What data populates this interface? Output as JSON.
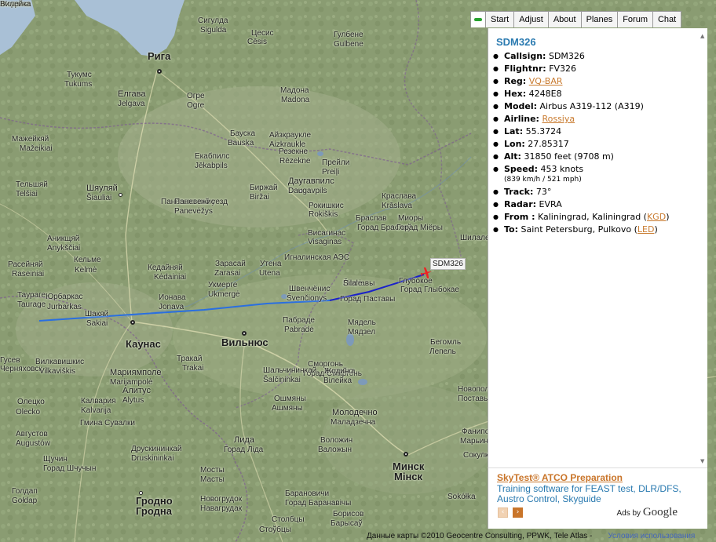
{
  "tabs": [
    "Start",
    "Adjust",
    "About",
    "Planes",
    "Forum",
    "Chat"
  ],
  "flight": {
    "title": "SDM326",
    "rows": [
      {
        "label": "Callsign:",
        "value": "SDM326"
      },
      {
        "label": "Flightnr:",
        "value": "FV326"
      },
      {
        "label": "Reg:",
        "value": "VQ-BAR",
        "link": true
      },
      {
        "label": "Hex:",
        "value": "4248E8"
      },
      {
        "label": "Model:",
        "value": "Airbus A319-112 (A319)"
      },
      {
        "label": "Airline:",
        "value": "Rossiya",
        "link": true
      },
      {
        "label": "Lat:",
        "value": "55.3724"
      },
      {
        "label": "Lon:",
        "value": "27.85317"
      },
      {
        "label": "Alt:",
        "value": "31850 feet (9708 m)"
      },
      {
        "label": "Speed:",
        "value": "453 knots",
        "sub": "(839 km/h / 521 mph)"
      },
      {
        "label": "Track:",
        "value": "73°"
      },
      {
        "label": "Radar:",
        "value": "EVRA"
      }
    ],
    "from": {
      "label": "From :",
      "value": "Kaliningrad, Kaliningrad (",
      "code": "KGD",
      "tail": ")"
    },
    "to": {
      "label": "To:",
      "value": "Saint Petersburg, Pulkovo (",
      "code": "LED",
      "tail": ")"
    }
  },
  "ad": {
    "title": "SkyTest® ATCO Preparation",
    "body": "Training software for FEAST test, DLR/DFS, Austro Control, Skyguide",
    "ads_by": "Ads by",
    "brand": "Google"
  },
  "map": {
    "plane_label": "SDM326",
    "attribution": "Данные карты ©2010 Geocentre Consulting, PPWK, Tele Atlas -",
    "terms": "Условия использования",
    "labels": [
      {
        "t": "Рига",
        "cls": "major"
      },
      {
        "t": "Елгава",
        "cls": "medium"
      },
      {
        "t": "Jelgava",
        "cls": ""
      },
      {
        "t": "Шяуляй",
        "cls": "medium"
      },
      {
        "t": "Šiauliai",
        "cls": ""
      },
      {
        "t": "Панeвежский уезд",
        "cls": ""
      },
      {
        "t": "Даугавпилс",
        "cls": "medium"
      },
      {
        "t": "Daugavpils",
        "cls": ""
      },
      {
        "t": "Каунас",
        "cls": "major"
      },
      {
        "t": "Вильнюс",
        "cls": "major"
      },
      {
        "t": "Минск",
        "cls": "major"
      },
      {
        "t": "Мінск",
        "cls": "major"
      },
      {
        "t": "Мариямполе",
        "cls": "medium"
      },
      {
        "t": "Marijampolė",
        "cls": ""
      },
      {
        "t": "Алитус",
        "cls": "medium"
      },
      {
        "t": "Alytus",
        "cls": ""
      },
      {
        "t": "Гродно",
        "cls": "major"
      },
      {
        "t": "Гродна",
        "cls": "major"
      },
      {
        "t": "Лида",
        "cls": "medium"
      },
      {
        "t": "Горад Ліда",
        "cls": ""
      },
      {
        "t": "Молодечно",
        "cls": "medium"
      },
      {
        "t": "Маладзечна",
        "cls": ""
      },
      {
        "t": "Поставы",
        "cls": ""
      },
      {
        "t": "Горад Паставы",
        "cls": ""
      },
      {
        "t": "Глубокое",
        "cls": ""
      },
      {
        "t": "Горад Глыбокае",
        "cls": ""
      },
      {
        "t": "Мядель",
        "cls": ""
      },
      {
        "t": "Мядзел",
        "cls": ""
      },
      {
        "t": "Кедайняй",
        "cls": ""
      },
      {
        "t": "Kėdainiai",
        "cls": ""
      },
      {
        "t": "Утена",
        "cls": ""
      },
      {
        "t": "Utena",
        "cls": ""
      },
      {
        "t": "Паневежис",
        "cls": ""
      },
      {
        "t": "Panevėžys",
        "cls": ""
      },
      {
        "t": "Тельшяй",
        "cls": ""
      },
      {
        "t": "Telšiai",
        "cls": ""
      },
      {
        "t": "Мажейкяй",
        "cls": ""
      },
      {
        "t": "Mažeikiai",
        "cls": ""
      },
      {
        "t": "Тукумс",
        "cls": ""
      },
      {
        "t": "Tukums",
        "cls": ""
      },
      {
        "t": "Огре",
        "cls": ""
      },
      {
        "t": "Ogre",
        "cls": ""
      },
      {
        "t": "Мадона",
        "cls": ""
      },
      {
        "t": "Madona",
        "cls": ""
      },
      {
        "t": "Резекне",
        "cls": ""
      },
      {
        "t": "Rēzekne",
        "cls": ""
      },
      {
        "t": "Прейли",
        "cls": ""
      },
      {
        "t": "Preiļi",
        "cls": ""
      },
      {
        "t": "Краслава",
        "cls": ""
      },
      {
        "t": "Krāslava",
        "cls": ""
      },
      {
        "t": "Браслав",
        "cls": ""
      },
      {
        "t": "Горад Браслаў",
        "cls": ""
      },
      {
        "t": "Миоры",
        "cls": ""
      },
      {
        "t": "Горад Міёры",
        "cls": ""
      },
      {
        "t": "Тракай",
        "cls": ""
      },
      {
        "t": "Trakai",
        "cls": ""
      },
      {
        "t": "Сморгонь",
        "cls": ""
      },
      {
        "t": "Горад Смаргонь",
        "cls": ""
      },
      {
        "t": "Вилейка",
        "cls": ""
      },
      {
        "t": "Вілейка",
        "cls": ""
      },
      {
        "t": "Ошмяны",
        "cls": ""
      },
      {
        "t": "Ашмяны",
        "cls": ""
      },
      {
        "t": "Воложин",
        "cls": ""
      },
      {
        "t": "Валожын",
        "cls": ""
      },
      {
        "t": "Гусев",
        "cls": ""
      },
      {
        "t": "Черняховск",
        "cls": ""
      },
      {
        "t": "Таураге",
        "cls": ""
      },
      {
        "t": "Taurage",
        "cls": ""
      },
      {
        "t": "Юрбаркас",
        "cls": ""
      },
      {
        "t": "Jurbarkas",
        "cls": ""
      },
      {
        "t": "Шакяй",
        "cls": ""
      },
      {
        "t": "Sakiai",
        "cls": ""
      },
      {
        "t": "Вилкавишкис",
        "cls": ""
      },
      {
        "t": "Vilkaviškis",
        "cls": ""
      },
      {
        "t": "Калвария",
        "cls": ""
      },
      {
        "t": "Kalvarija",
        "cls": ""
      },
      {
        "t": "Гмина Сувалки",
        "cls": ""
      },
      {
        "t": "Друскининкай",
        "cls": ""
      },
      {
        "t": "Druskininkai",
        "cls": ""
      },
      {
        "t": "Ионава",
        "cls": ""
      },
      {
        "t": "Jonava",
        "cls": ""
      },
      {
        "t": "Укмерге",
        "cls": ""
      },
      {
        "t": "Ukmergė",
        "cls": ""
      },
      {
        "t": "Швенчёнис",
        "cls": ""
      },
      {
        "t": "Švenčionys",
        "cls": ""
      },
      {
        "t": "Игналинская АЭС",
        "cls": ""
      },
      {
        "t": "Висагинас",
        "cls": ""
      },
      {
        "t": "Visaginas",
        "cls": ""
      },
      {
        "t": "Пабраде",
        "cls": ""
      },
      {
        "t": "Pabradė",
        "cls": ""
      },
      {
        "t": "Шальчининкай",
        "cls": ""
      },
      {
        "t": "Šalčininkai",
        "cls": ""
      },
      {
        "t": "Бегомль",
        "cls": ""
      },
      {
        "t": "Лепель",
        "cls": ""
      },
      {
        "t": "Сигулда",
        "cls": ""
      },
      {
        "t": "Sigulda",
        "cls": ""
      },
      {
        "t": "Цесис",
        "cls": ""
      },
      {
        "t": "Cēsis",
        "cls": ""
      },
      {
        "t": "Гулбене",
        "cls": ""
      },
      {
        "t": "Gulbene",
        "cls": ""
      },
      {
        "t": "Бауска",
        "cls": ""
      },
      {
        "t": "Bauska",
        "cls": ""
      },
      {
        "t": "Айзкраукле",
        "cls": ""
      },
      {
        "t": "Aizkraukle",
        "cls": ""
      },
      {
        "t": "Екабпилс",
        "cls": ""
      },
      {
        "t": "Jēkabpils",
        "cls": ""
      },
      {
        "t": "Биржай",
        "cls": ""
      },
      {
        "t": "Biržai",
        "cls": ""
      },
      {
        "t": "Рокишкис",
        "cls": ""
      },
      {
        "t": "Rokiškis",
        "cls": ""
      },
      {
        "t": "Зарасай",
        "cls": ""
      },
      {
        "t": "Zarasai",
        "cls": ""
      },
      {
        "t": "Аникщяй",
        "cls": ""
      },
      {
        "t": "Anykščiai",
        "cls": ""
      },
      {
        "t": "Кельме",
        "cls": ""
      },
      {
        "t": "Kelmė",
        "cls": ""
      },
      {
        "t": "Расейняй",
        "cls": ""
      },
      {
        "t": "Raseiniai",
        "cls": ""
      },
      {
        "t": "Шилале",
        "cls": ""
      },
      {
        "t": "Šilalė",
        "cls": ""
      },
      {
        "t": "Новополоцк",
        "cls": ""
      },
      {
        "t": "Поставы",
        "cls": ""
      },
      {
        "t": "Борисов",
        "cls": ""
      },
      {
        "t": "Барысаў",
        "cls": ""
      },
      {
        "t": "Столбцы",
        "cls": ""
      },
      {
        "t": "Стоўбцы",
        "cls": ""
      },
      {
        "t": "Барановичи",
        "cls": ""
      },
      {
        "t": "Горад Баранавічы",
        "cls": ""
      },
      {
        "t": "Новогрудок",
        "cls": ""
      },
      {
        "t": "Навагрудак",
        "cls": ""
      },
      {
        "t": "Мосты",
        "cls": ""
      },
      {
        "t": "Масты",
        "cls": ""
      },
      {
        "t": "Щучин",
        "cls": ""
      },
      {
        "t": "Горад Шчучын",
        "cls": ""
      },
      {
        "t": "Августов",
        "cls": ""
      },
      {
        "t": "Augustów",
        "cls": ""
      },
      {
        "t": "Олецко",
        "cls": ""
      },
      {
        "t": "Olecko",
        "cls": ""
      },
      {
        "t": "Голдап",
        "cls": ""
      },
      {
        "t": "Gołdap",
        "cls": ""
      },
      {
        "t": "Сокулка",
        "cls": ""
      },
      {
        "t": "Sokółka",
        "cls": ""
      },
      {
        "t": "Фаниполь",
        "cls": ""
      },
      {
        "t": "Марьина Горка",
        "cls": ""
      },
      {
        "t": "Жодино",
        "cls": ""
      },
      {
        "t": "Жодзіна",
        "cls": ""
      },
      {
        "t": "Вилейка",
        "cls": ""
      }
    ]
  }
}
